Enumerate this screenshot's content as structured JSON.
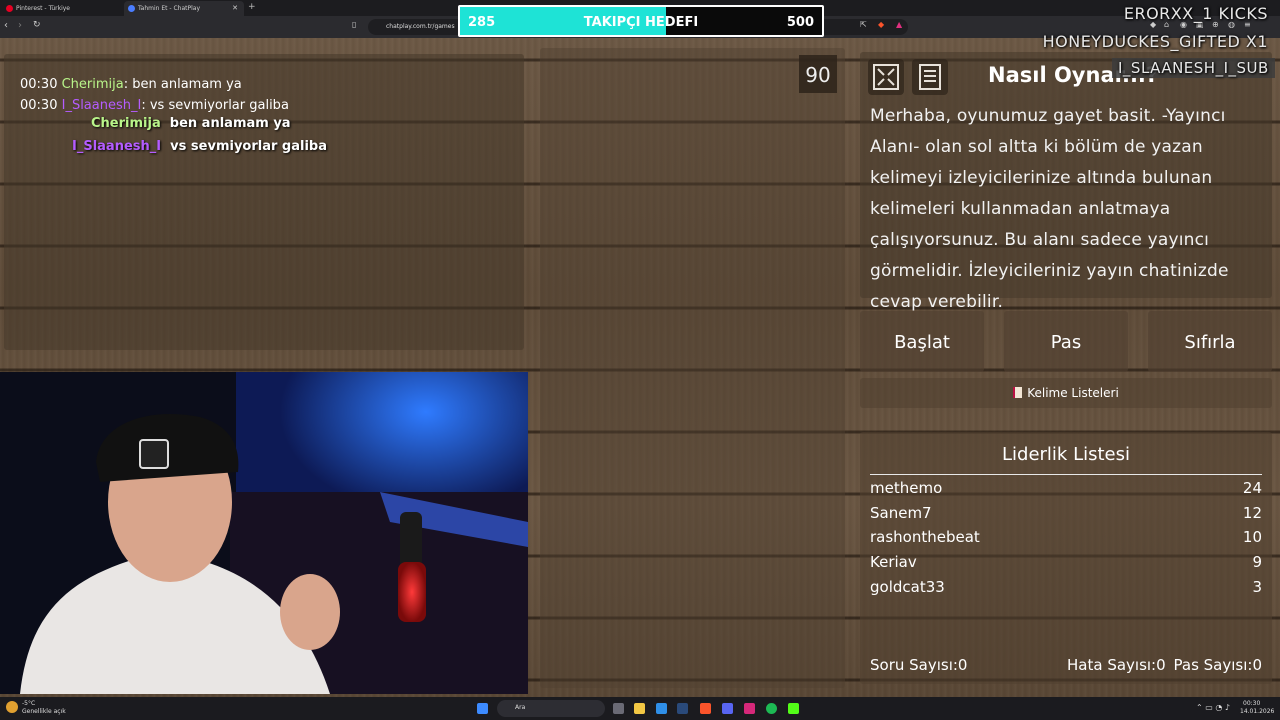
{
  "browser": {
    "tabs": [
      {
        "label": "Pinterest - Türkiye",
        "color": "#e60023"
      },
      {
        "label": "Tahmin Et - ChatPlay",
        "color": "#4a7dff"
      }
    ],
    "new_tab": "+",
    "url": "chatplay.com.tr/games"
  },
  "goal": {
    "title": "TAKIPÇI HEDEFI",
    "current": "285",
    "target": "500",
    "progress": 0.57,
    "fill_color": "#1ee3d6"
  },
  "alerts": [
    "ERORXX_1 KICKS",
    "HONEYDUCKES_GIFTED X1",
    "I_SLAANESH_I_SUB"
  ],
  "chat": {
    "messages": [
      {
        "time": "00:30",
        "user": "Cherimija",
        "sep": ":",
        "text": "ben anlamam ya",
        "color": "#b9f58a"
      },
      {
        "time": "00:30",
        "user": "I_Slaanesh_I",
        "sep": ":",
        "text": "vs sevmiyorlar galiba",
        "color": "#b45cff"
      }
    ],
    "overlay": [
      {
        "user": "Cherimija",
        "text": "ben anlamam ya",
        "color": "#b9f58a"
      },
      {
        "user": "I_Slaanesh_I",
        "text": "vs sevmiyorlar galiba",
        "color": "#b45cff"
      }
    ]
  },
  "game": {
    "timer": "90",
    "howto_title": "Nasıl Oynar...?",
    "howto_text": "Merhaba, oyunumuz gayet basit. -Yayıncı Alanı- olan sol altta ki bölüm de yazan kelimeyi izleyicilerinize altında bulunan kelimeleri kullanmadan anlatmaya çalışıyorsunuz. Bu alanı sadece yayıncı görmelidir. İzleyicileriniz yayın chatinizde cevap verebilir.",
    "buttons": {
      "start": "Başlat",
      "pass": "Pas",
      "reset": "Sıfırla"
    },
    "word_lists": "Kelime Listeleri",
    "leaderboard": {
      "title": "Liderlik Listesi",
      "rows": [
        {
          "name": "methemo",
          "score": "24"
        },
        {
          "name": "Sanem7",
          "score": "12"
        },
        {
          "name": "rashonthebeat",
          "score": "10"
        },
        {
          "name": "Keriav",
          "score": "9"
        },
        {
          "name": "goldcat33",
          "score": "3"
        }
      ],
      "stats": {
        "questions": "Soru Sayısı:0",
        "errors": "Hata Sayısı:0",
        "passes": "Pas Sayısı:0"
      }
    }
  },
  "taskbar": {
    "weather_temp": "-5°C",
    "weather_desc": "Genellikle açık",
    "search": "Ara",
    "time": "00:30",
    "date": "14.01.2026"
  }
}
